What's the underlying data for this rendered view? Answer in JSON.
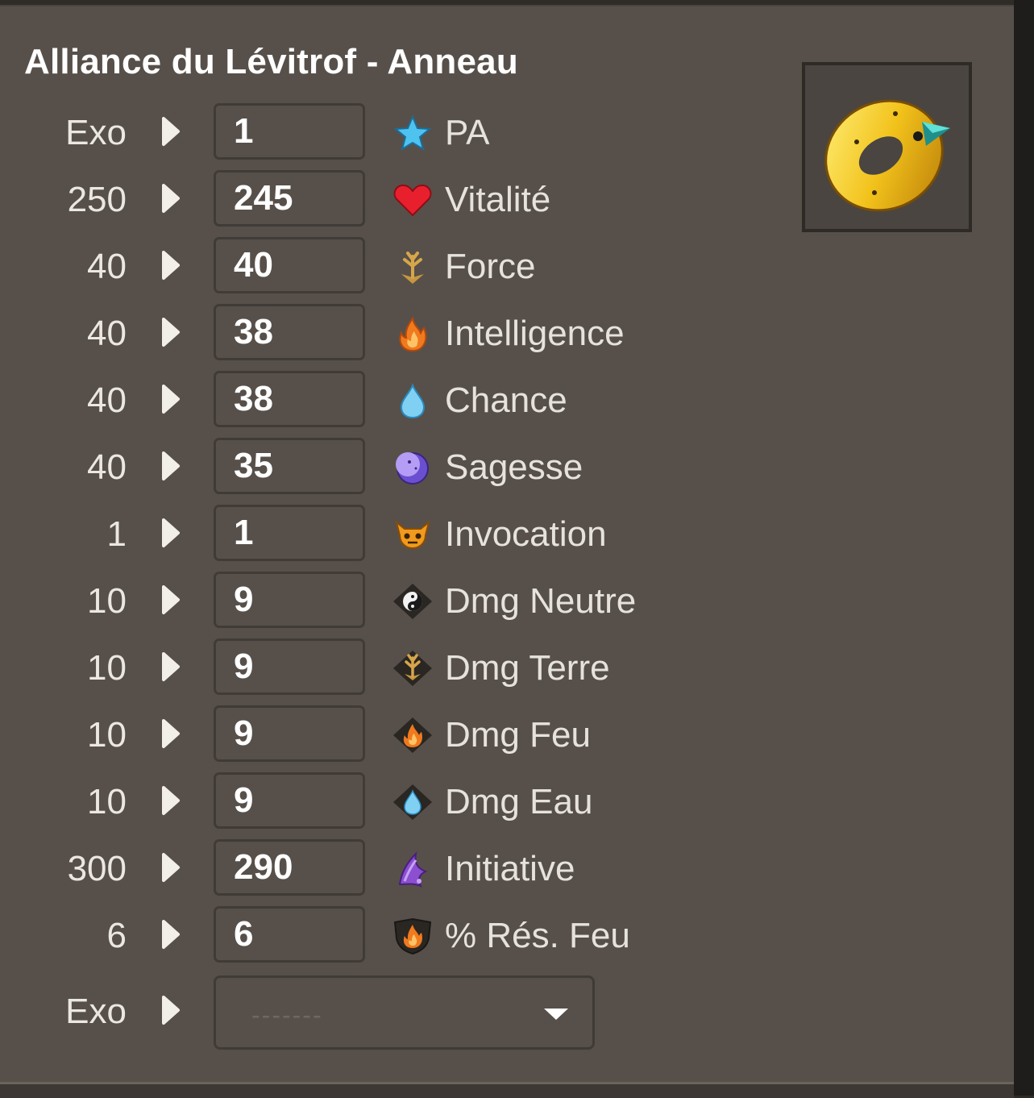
{
  "title": "Alliance du Lévitrof - Anneau",
  "item_image": "golden-ring-with-spike-icon",
  "stats": [
    {
      "max": "Exo",
      "value": "1",
      "label": "PA",
      "icon": "star-icon"
    },
    {
      "max": "250",
      "value": "245",
      "label": "Vitalité",
      "icon": "heart-icon"
    },
    {
      "max": "40",
      "value": "40",
      "label": "Force",
      "icon": "earth-icon"
    },
    {
      "max": "40",
      "value": "38",
      "label": "Intelligence",
      "icon": "fire-icon"
    },
    {
      "max": "40",
      "value": "38",
      "label": "Chance",
      "icon": "water-drop-icon"
    },
    {
      "max": "40",
      "value": "35",
      "label": "Sagesse",
      "icon": "moon-icon"
    },
    {
      "max": "1",
      "value": "1",
      "label": "Invocation",
      "icon": "summon-icon"
    },
    {
      "max": "10",
      "value": "9",
      "label": "Dmg Neutre",
      "icon": "neutral-damage-icon"
    },
    {
      "max": "10",
      "value": "9",
      "label": "Dmg Terre",
      "icon": "earth-damage-icon"
    },
    {
      "max": "10",
      "value": "9",
      "label": "Dmg Feu",
      "icon": "fire-damage-icon"
    },
    {
      "max": "10",
      "value": "9",
      "label": "Dmg Eau",
      "icon": "water-damage-icon"
    },
    {
      "max": "300",
      "value": "290",
      "label": "Initiative",
      "icon": "initiative-icon"
    },
    {
      "max": "6",
      "value": "6",
      "label": "% Rés. Feu",
      "icon": "fire-resistance-icon"
    }
  ],
  "exo_select": {
    "caption": "Exo",
    "selected": "-------"
  },
  "colors": {
    "panel": "#57504a",
    "text": "#e6e2dc",
    "input_border": "#403b36"
  }
}
